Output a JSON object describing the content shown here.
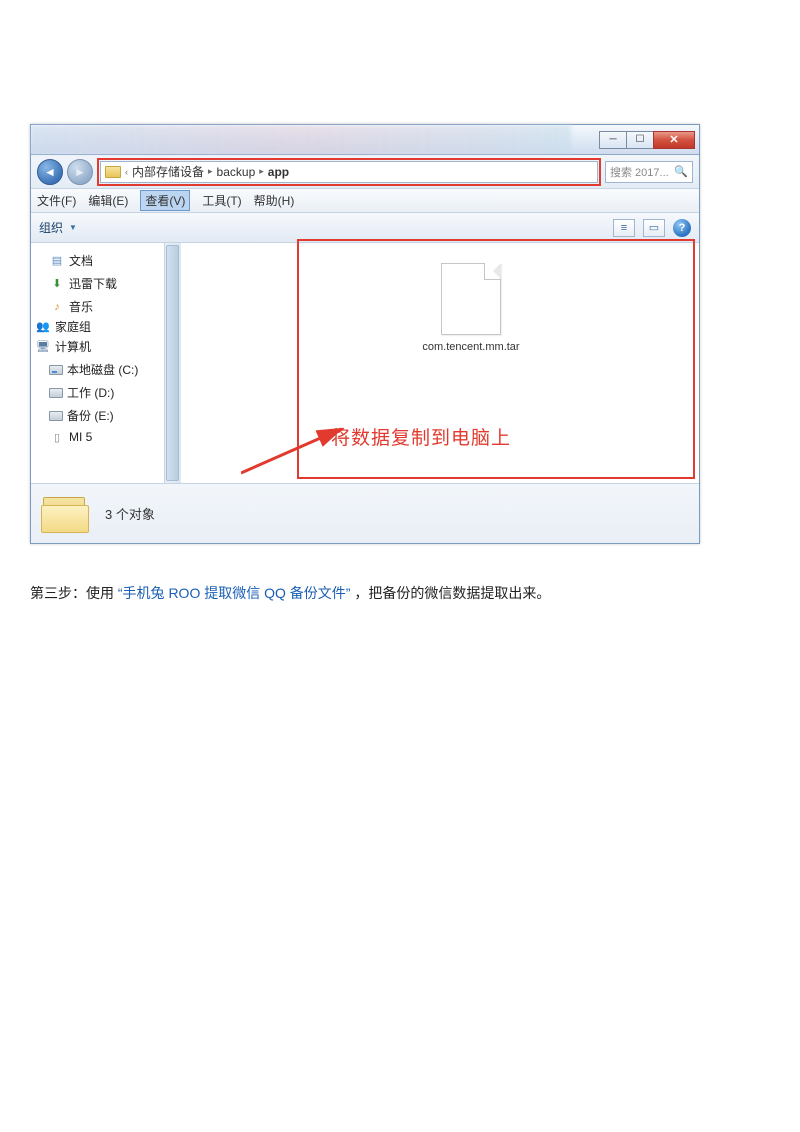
{
  "window": {
    "breadcrumb": [
      "内部存储设备",
      "backup",
      "app"
    ],
    "search_placeholder": "搜索 2017...",
    "menu": {
      "file": "文件(F)",
      "edit": "编辑(E)",
      "view": "查看(V)",
      "tools": "工具(T)",
      "help": "帮助(H)"
    },
    "toolbar": {
      "organize": "组织"
    },
    "sidebar": {
      "docs": "文档",
      "thunder": "迅雷下载",
      "music": "音乐",
      "homegroup": "家庭组",
      "computer": "计算机",
      "local_c": "本地磁盘 (C:)",
      "work_d": "工作 (D:)",
      "backup_e": "备份 (E:)",
      "mi5": "MI 5"
    },
    "file": {
      "name": "com.tencent.mm.tar"
    },
    "annotation": "将数据复制到电脑上",
    "status": "3 个对象"
  },
  "caption": {
    "prefix": "第三步：使用",
    "link": "“手机兔 ROO 提取微信 QQ 备份文件”",
    "suffix": " ，把备份的微信数据提取出来。"
  }
}
